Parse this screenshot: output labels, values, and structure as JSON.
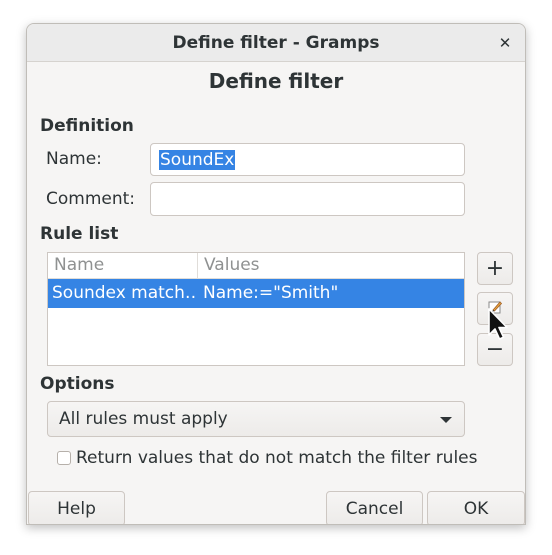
{
  "window": {
    "title": "Define filter - Gramps"
  },
  "dialog": {
    "heading": "Define filter",
    "definition": {
      "section_label": "Definition",
      "name_label": "Name:",
      "name_value": "SoundEx",
      "comment_label": "Comment:",
      "comment_value": ""
    },
    "rule_list": {
      "section_label": "Rule list",
      "columns": [
        "Name",
        "Values"
      ],
      "rows": [
        {
          "name": "Soundex match…",
          "values": "Name:=\"Smith\""
        }
      ],
      "buttons": {
        "add": "+",
        "remove": "−"
      }
    },
    "options": {
      "section_label": "Options",
      "combo_value": "All rules must apply",
      "invert_label": "Return values that do not match the filter rules",
      "invert_checked": false
    },
    "footer": {
      "help": "Help",
      "cancel": "Cancel",
      "ok": "OK"
    }
  },
  "colors": {
    "selection": "#3584e4",
    "window_bg": "#f6f5f4"
  },
  "icons": {
    "close": "close-icon",
    "edit": "edit-icon",
    "cursor": "mouse-pointer-icon"
  }
}
